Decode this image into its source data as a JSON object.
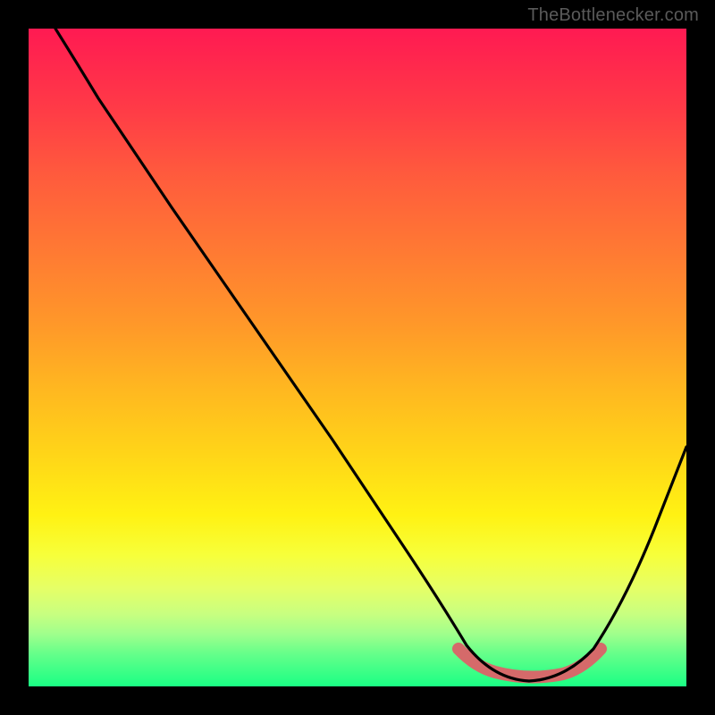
{
  "watermark": "TheBottlenecker.com",
  "chart_data": {
    "type": "line",
    "title": "",
    "xlabel": "",
    "ylabel": "",
    "xlim": [
      0,
      100
    ],
    "ylim": [
      0,
      100
    ],
    "grid": false,
    "legend": false,
    "series": [
      {
        "name": "bottleneck-curve",
        "x": [
          4,
          10,
          20,
          30,
          40,
          50,
          60,
          66,
          70,
          74,
          78,
          82,
          86,
          90,
          94,
          100
        ],
        "values": [
          100,
          90,
          75,
          60,
          46,
          32,
          18,
          8,
          3,
          1,
          0.5,
          1,
          3,
          10,
          24,
          50
        ]
      },
      {
        "name": "recommended-range-marker",
        "x": [
          66,
          70,
          74,
          78,
          82,
          86
        ],
        "values": [
          6,
          3,
          2,
          2,
          3,
          6
        ]
      }
    ],
    "colors": {
      "curve": "#000000",
      "marker": "#d56a6a",
      "gradient_top": "#ff1a52",
      "gradient_bottom": "#1aff84"
    }
  }
}
